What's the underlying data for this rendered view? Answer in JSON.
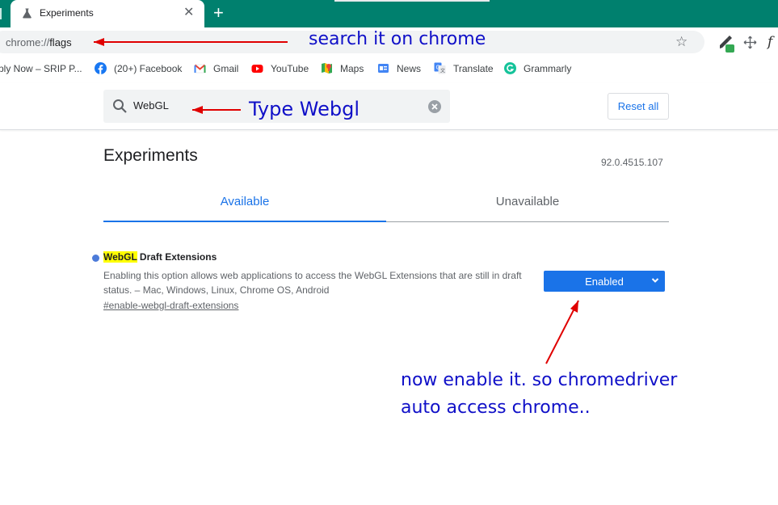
{
  "browser": {
    "tab_title": "Experiments",
    "tab_close": "✕",
    "new_tab": "+",
    "url_scheme": "chrome://",
    "url_host": "flags",
    "bookmark_star": "☆"
  },
  "bookmarks": [
    {
      "label": "ply Now – SRIP P...",
      "icon": "page-icon"
    },
    {
      "label": "(20+) Facebook",
      "icon": "facebook-icon"
    },
    {
      "label": "Gmail",
      "icon": "gmail-icon"
    },
    {
      "label": "YouTube",
      "icon": "youtube-icon"
    },
    {
      "label": "Maps",
      "icon": "maps-icon"
    },
    {
      "label": "News",
      "icon": "news-icon"
    },
    {
      "label": "Translate",
      "icon": "translate-icon"
    },
    {
      "label": "Grammarly",
      "icon": "grammarly-icon"
    }
  ],
  "flags_page": {
    "search_value": "WebGL",
    "reset_label": "Reset all",
    "title": "Experiments",
    "version": "92.0.4515.107",
    "tabs": [
      {
        "label": "Available",
        "selected": true
      },
      {
        "label": "Unavailable",
        "selected": false
      }
    ],
    "flag": {
      "name_highlight": "WebGL",
      "name_rest": " Draft Extensions",
      "description": "Enabling this option allows web applications to access the WebGL Extensions that are still in draft status. – Mac, Windows, Linux, Chrome OS, Android",
      "link": "#enable-webgl-draft-extensions",
      "selected_option": "Enabled"
    }
  },
  "annotations": {
    "note1": "search it on chrome",
    "note2": "Type Webgl",
    "note3_line1": "now enable it. so chromedriver",
    "note3_line2": "auto access chrome.."
  },
  "colors": {
    "tabstrip": "#00806e",
    "accent": "#1a73e8",
    "annotation_text": "#1010c8",
    "annotation_arrow": "#e00000",
    "search_highlight": "#ffff00"
  }
}
